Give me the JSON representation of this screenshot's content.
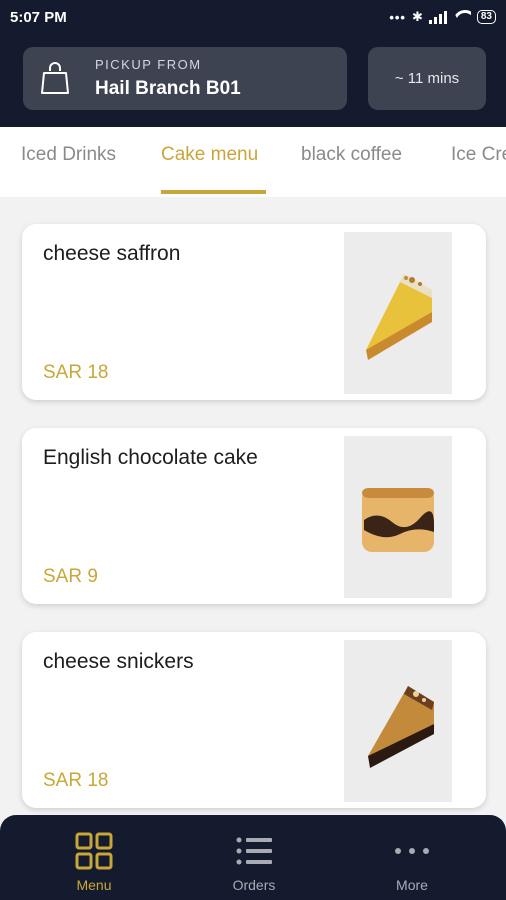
{
  "status_bar": {
    "time": "5:07 PM",
    "battery": "83"
  },
  "pickup": {
    "label": "PICKUP FROM",
    "branch": "Hail Branch B01",
    "icon": "shopping-bag-icon"
  },
  "eta": {
    "text": "~ 11 mins"
  },
  "tabs": [
    {
      "label": "Iced Drinks",
      "active": false
    },
    {
      "label": "Cake menu",
      "active": true
    },
    {
      "label": "black coffee",
      "active": false
    },
    {
      "label": "Ice Cream",
      "active": false
    }
  ],
  "menu_items": [
    {
      "name": "cheese saffron",
      "price": "SAR 18",
      "image": "cheese-saffron-cake-slice"
    },
    {
      "name": "English chocolate cake",
      "price": "SAR 9",
      "image": "english-chocolate-cake-slice"
    },
    {
      "name": "cheese snickers",
      "price": "SAR 18",
      "image": "cheese-snickers-cake-slice"
    }
  ],
  "bottom_nav": [
    {
      "label": "Menu",
      "icon": "grid-icon",
      "active": true
    },
    {
      "label": "Orders",
      "icon": "list-icon",
      "active": false
    },
    {
      "label": "More",
      "icon": "more-dots-icon",
      "active": false
    }
  ],
  "colors": {
    "header_bg": "#151b2e",
    "accent": "#c9a63a",
    "pill_bg": "#3e4352"
  }
}
